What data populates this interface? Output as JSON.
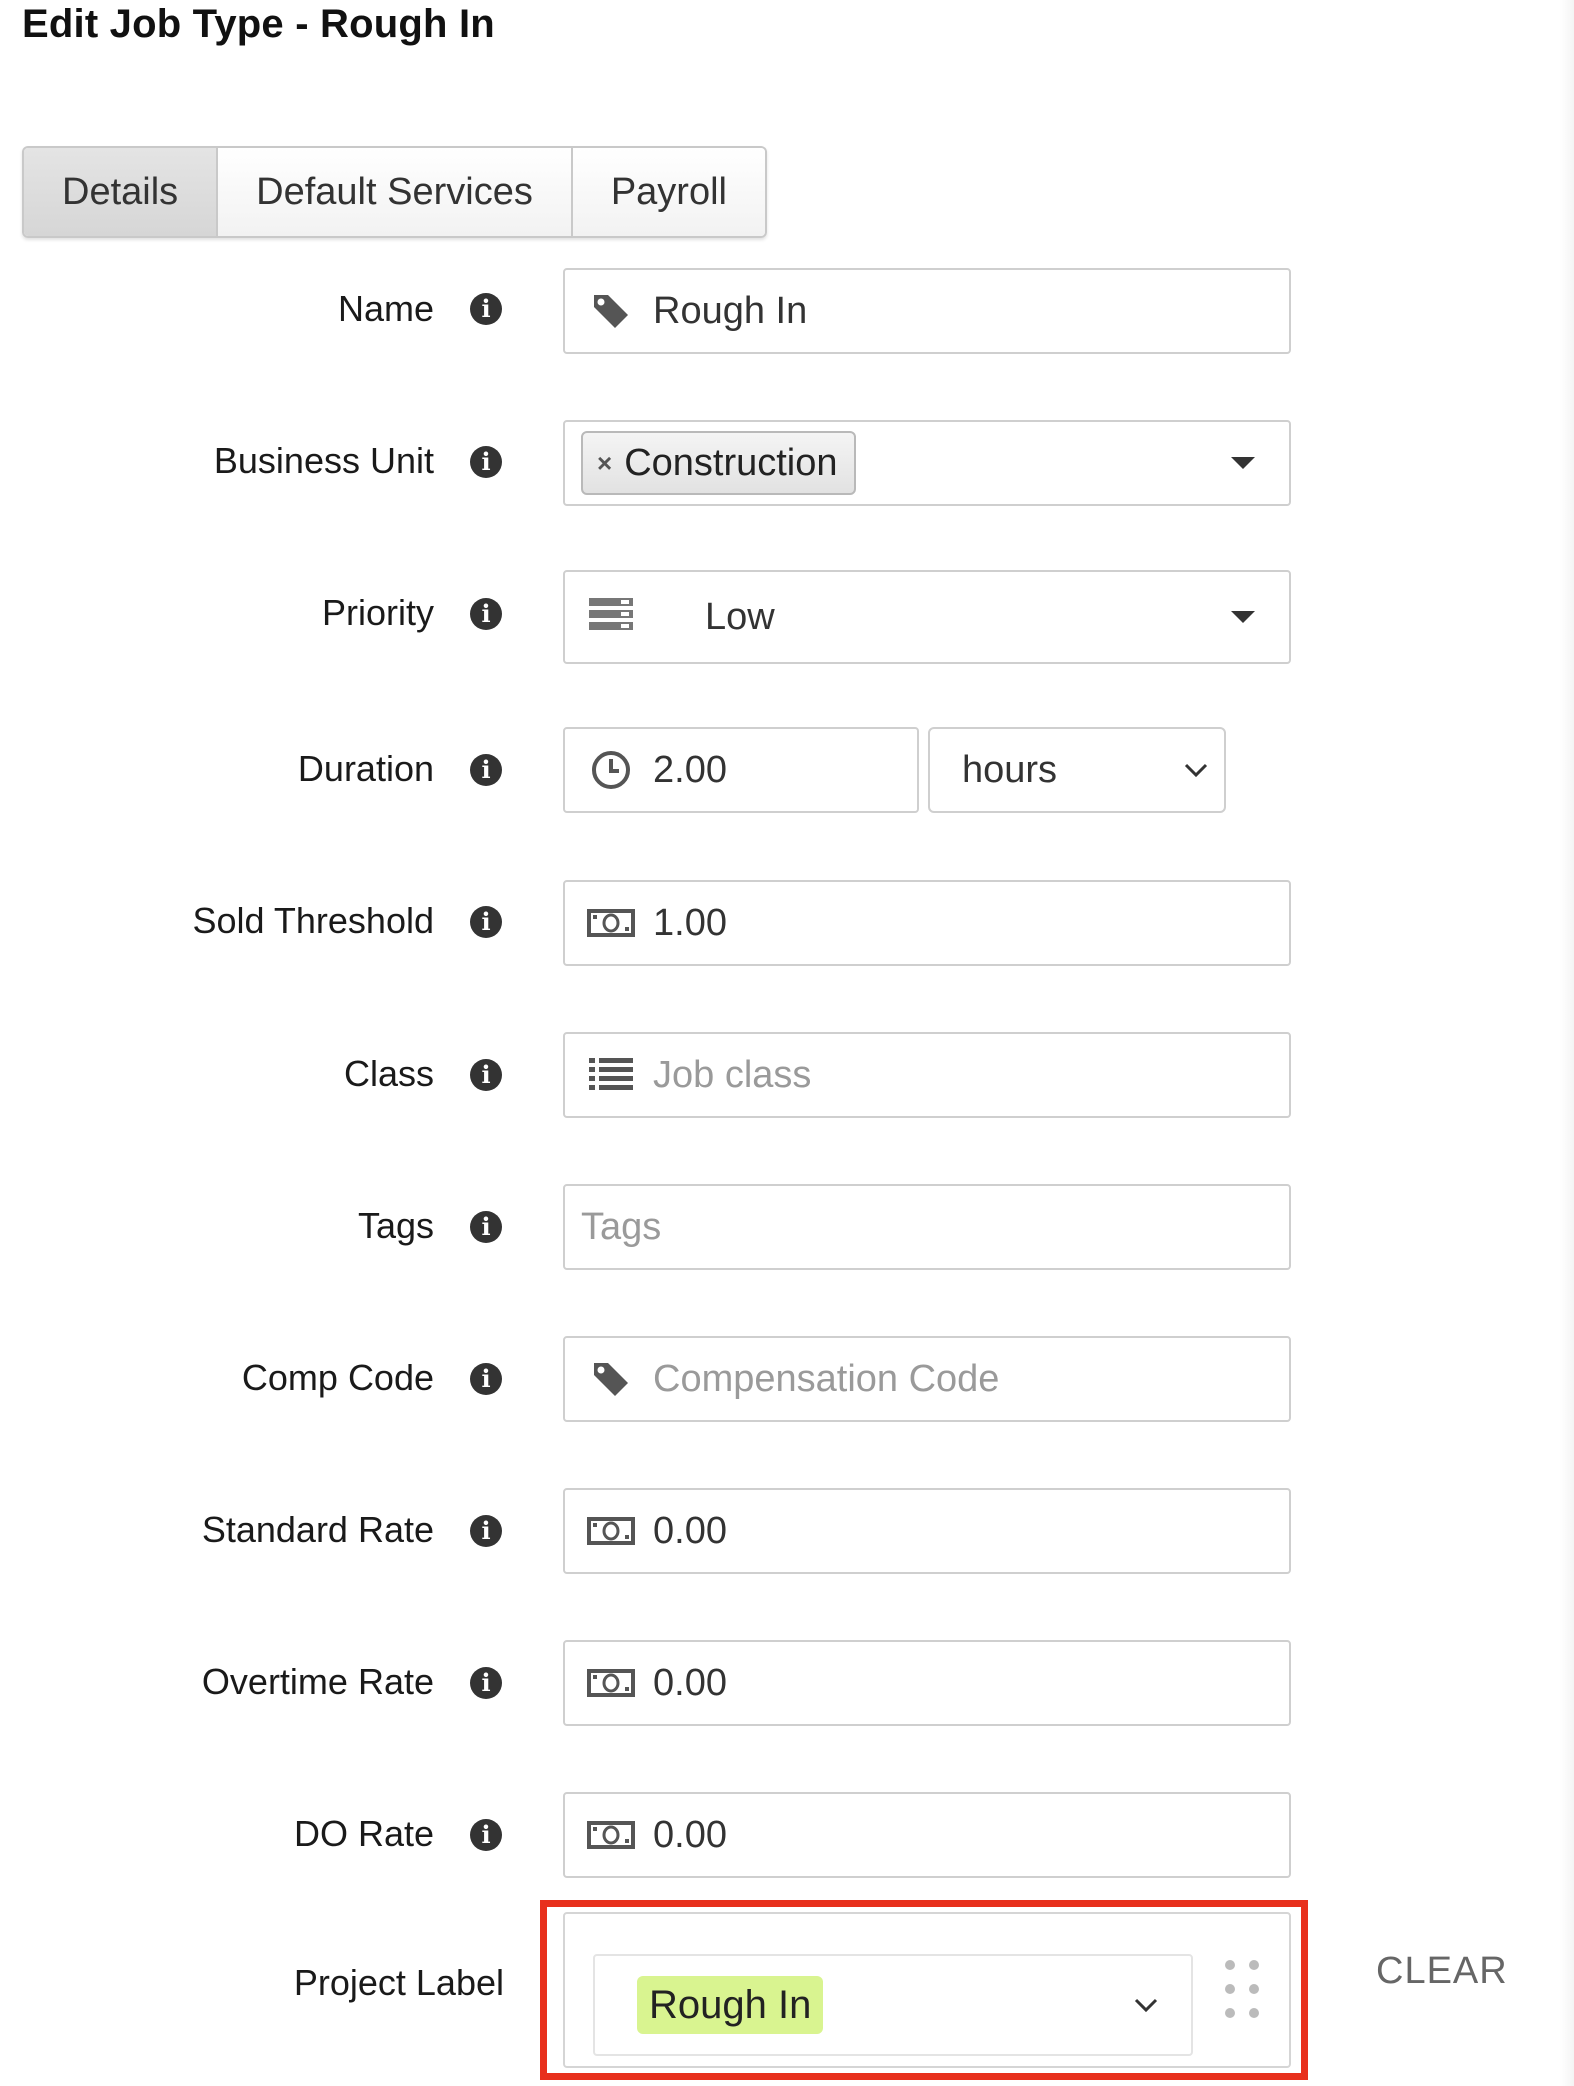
{
  "page": {
    "title": "Edit Job Type - Rough In"
  },
  "tabs": [
    {
      "label": "Details",
      "active": true
    },
    {
      "label": "Default Services",
      "active": false
    },
    {
      "label": "Payroll",
      "active": false
    }
  ],
  "form": {
    "name": {
      "label": "Name",
      "value": "Rough In",
      "icon": "tag-icon"
    },
    "business_unit": {
      "label": "Business Unit",
      "selected": "Construction",
      "remove_glyph": "×"
    },
    "priority": {
      "label": "Priority",
      "value": "Low",
      "icon": "priority-bars-icon"
    },
    "duration": {
      "label": "Duration",
      "value": "2.00",
      "unit": "hours",
      "icon": "clock-icon"
    },
    "sold_threshold": {
      "label": "Sold Threshold",
      "value": "1.00",
      "icon": "money-icon"
    },
    "class": {
      "label": "Class",
      "placeholder": "Job class",
      "icon": "list-icon"
    },
    "tags": {
      "label": "Tags",
      "placeholder": "Tags"
    },
    "comp_code": {
      "label": "Comp Code",
      "placeholder": "Compensation Code",
      "icon": "tag-icon"
    },
    "standard_rate": {
      "label": "Standard Rate",
      "value": "0.00",
      "icon": "money-icon"
    },
    "overtime_rate": {
      "label": "Overtime Rate",
      "value": "0.00",
      "icon": "money-icon"
    },
    "do_rate": {
      "label": "DO Rate",
      "value": "0.00",
      "icon": "money-icon"
    },
    "project_label": {
      "label": "Project Label",
      "selected": "Rough In",
      "tag_color": "#d9f490"
    }
  },
  "actions": {
    "clear_label": "CLEAR"
  },
  "colors": {
    "highlight": "#e8301c",
    "info_icon": "#333333"
  }
}
